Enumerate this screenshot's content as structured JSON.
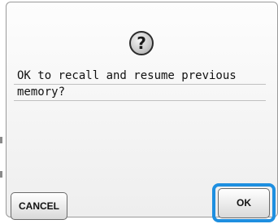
{
  "dialog": {
    "icon": "question-icon",
    "icon_glyph": "?",
    "message_lines": [
      "OK to recall and resume previous",
      "memory?"
    ]
  },
  "buttons": {
    "cancel_label": "CANCEL",
    "ok_label": "OK"
  },
  "colors": {
    "highlight": "#1e8fe0"
  }
}
